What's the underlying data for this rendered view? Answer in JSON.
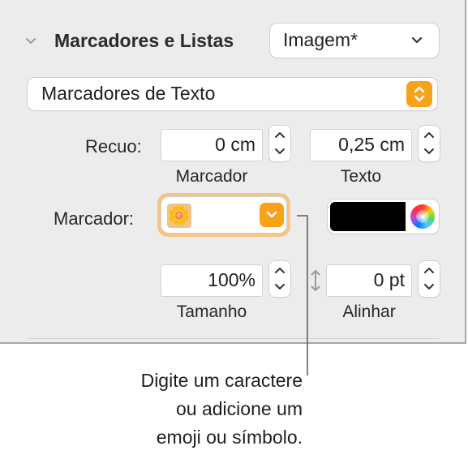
{
  "section": {
    "title": "Marcadores e Listas",
    "style_value": "Imagem*"
  },
  "bullet_type": {
    "value": "Marcadores de Texto"
  },
  "indent": {
    "label": "Recuo:",
    "bullet_value": "0 cm",
    "bullet_caption": "Marcador",
    "text_value": "0,25 cm",
    "text_caption": "Texto"
  },
  "bullet": {
    "label": "Marcador:",
    "glyph": "🌼",
    "color": "#000000"
  },
  "size": {
    "value": "100%",
    "caption": "Tamanho"
  },
  "align": {
    "value": "0 pt",
    "caption": "Alinhar"
  },
  "callout": {
    "line1": "Digite um caractere",
    "line2": "ou adicione um",
    "line3": "emoji ou símbolo."
  },
  "colors": {
    "accent": "#f8a21a",
    "panel": "#ececec"
  }
}
